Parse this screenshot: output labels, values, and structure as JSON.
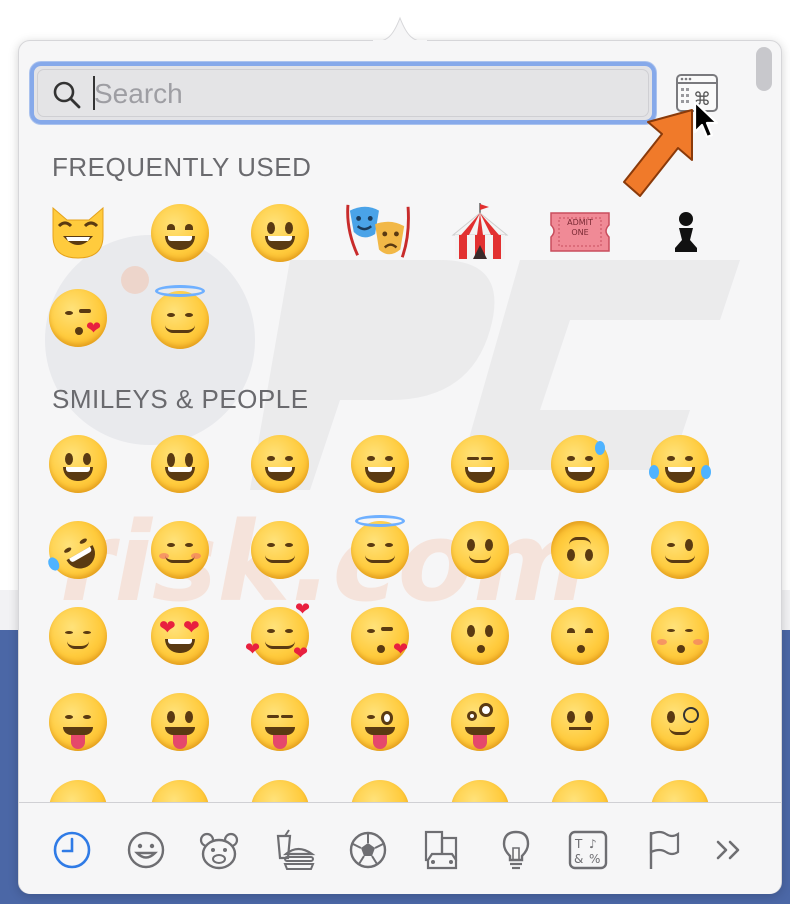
{
  "search": {
    "placeholder": "Search",
    "value": ""
  },
  "sections": {
    "frequently_used": "FREQUENTLY USED",
    "smileys_people": "SMILEYS & PEOPLE"
  },
  "frequently_used": [
    {
      "name": "grinning-cat-face",
      "glyph": "😸"
    },
    {
      "name": "grinning-face-with-smiling-eyes",
      "glyph": "😁"
    },
    {
      "name": "grinning-face-with-big-eyes",
      "glyph": "😃"
    },
    {
      "name": "performing-arts",
      "glyph": "🎭"
    },
    {
      "name": "circus-tent",
      "glyph": "🎪"
    },
    {
      "name": "admission-tickets",
      "glyph": "🎟"
    },
    {
      "name": "chess-pawn",
      "glyph": "♟"
    },
    {
      "name": "face-blowing-a-kiss",
      "glyph": "😘"
    },
    {
      "name": "smiling-face-with-halo",
      "glyph": "😇"
    }
  ],
  "ticket_text": [
    "ADMIT",
    "ONE"
  ],
  "smileys_rows": [
    [
      "grinning",
      "grinning-big-eyes",
      "grinning-smiling-eyes",
      "beaming",
      "squinting-laughing",
      "grinning-sweat",
      "tears-of-joy"
    ],
    [
      "rolling-on-floor-laughing",
      "smiling-face",
      "smiling-smiling-eyes",
      "halo",
      "slightly-smiling",
      "upside-down",
      "winking"
    ],
    [
      "relieved",
      "heart-eyes",
      "smiling-hearts",
      "blowing-kiss",
      "kissing",
      "kissing-smiling-eyes",
      "kissing-closed-eyes"
    ],
    [
      "savoring-food",
      "tongue",
      "squinting-tongue",
      "winking-tongue",
      "zany",
      "raised-eyebrow",
      "monocle"
    ]
  ],
  "categories": [
    {
      "name": "recent",
      "icon": "clock-icon",
      "active": true
    },
    {
      "name": "smileys",
      "icon": "smiley-icon"
    },
    {
      "name": "animals",
      "icon": "bear-icon"
    },
    {
      "name": "food",
      "icon": "burger-icon"
    },
    {
      "name": "activity",
      "icon": "soccer-ball-icon"
    },
    {
      "name": "travel",
      "icon": "building-car-icon"
    },
    {
      "name": "objects",
      "icon": "lightbulb-icon"
    },
    {
      "name": "symbols",
      "icon": "symbols-icon"
    },
    {
      "name": "flags",
      "icon": "flag-icon"
    },
    {
      "name": "more",
      "icon": "double-chevron-right-icon"
    }
  ],
  "colors": {
    "accent": "#2f7be6",
    "focus_ring": "#86a9ea",
    "arrow": "#f07a2a",
    "header": "#6a6a6e"
  }
}
